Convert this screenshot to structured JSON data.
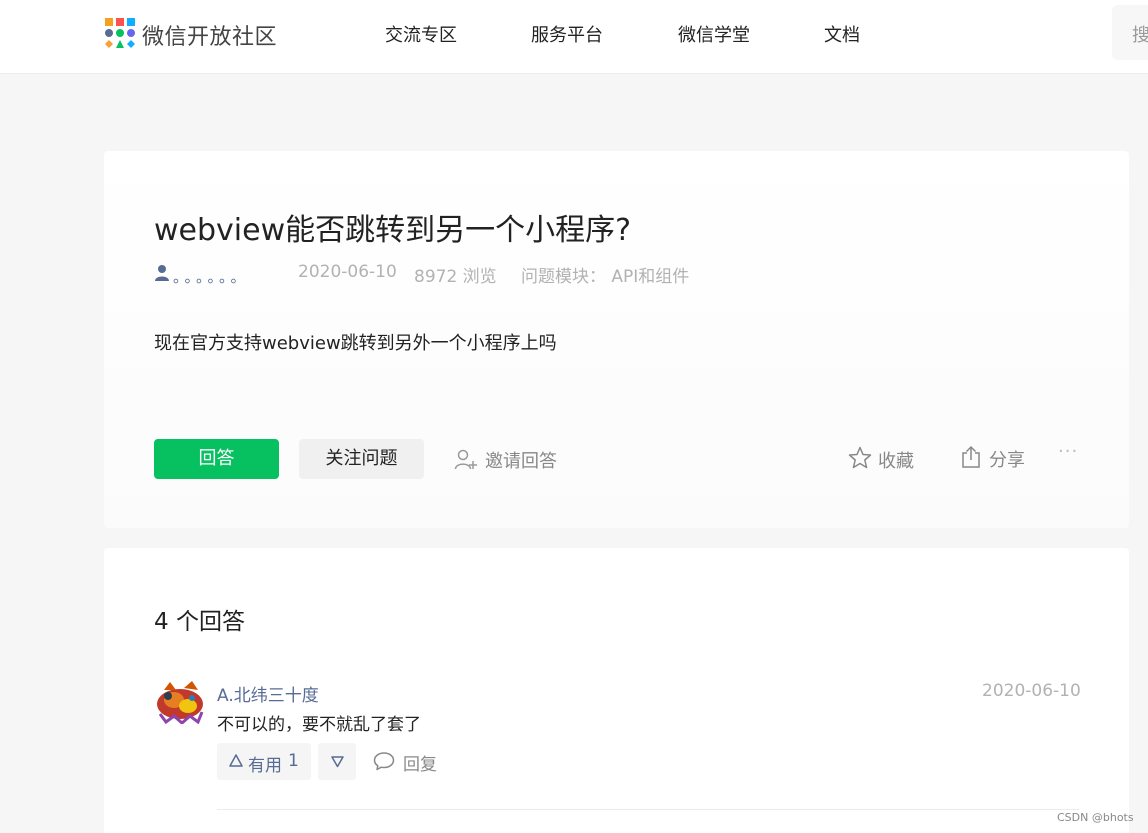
{
  "header": {
    "brand": "微信开放社区",
    "nav": [
      "交流专区",
      "服务平台",
      "微信学堂",
      "文档"
    ],
    "search_placeholder": "搜"
  },
  "question": {
    "title": "webview能否跳转到另一个小程序?",
    "author": "。。。。。。",
    "date": "2020-06-10",
    "views": "8972 浏览",
    "module": "问题模块：  API和组件",
    "body": "现在官方支持webview跳转到另外一个小程序上吗",
    "actions": {
      "answer": "回答",
      "follow": "关注问题",
      "invite": "邀请回答",
      "favorite": "收藏",
      "share": "分享",
      "more": "···"
    }
  },
  "answers": {
    "count_label": "4 个回答",
    "items": [
      {
        "user": "A.北纬三十度",
        "date": "2020-06-10",
        "text": "不可以的，要不就乱了套了",
        "useful_label": "有用",
        "useful_count": "1",
        "reply_label": "回复"
      }
    ]
  },
  "watermark": "CSDN @bhots",
  "colors": {
    "accent_green": "#07c160",
    "link_blue": "#576b95",
    "muted": "#b2b2b2"
  }
}
